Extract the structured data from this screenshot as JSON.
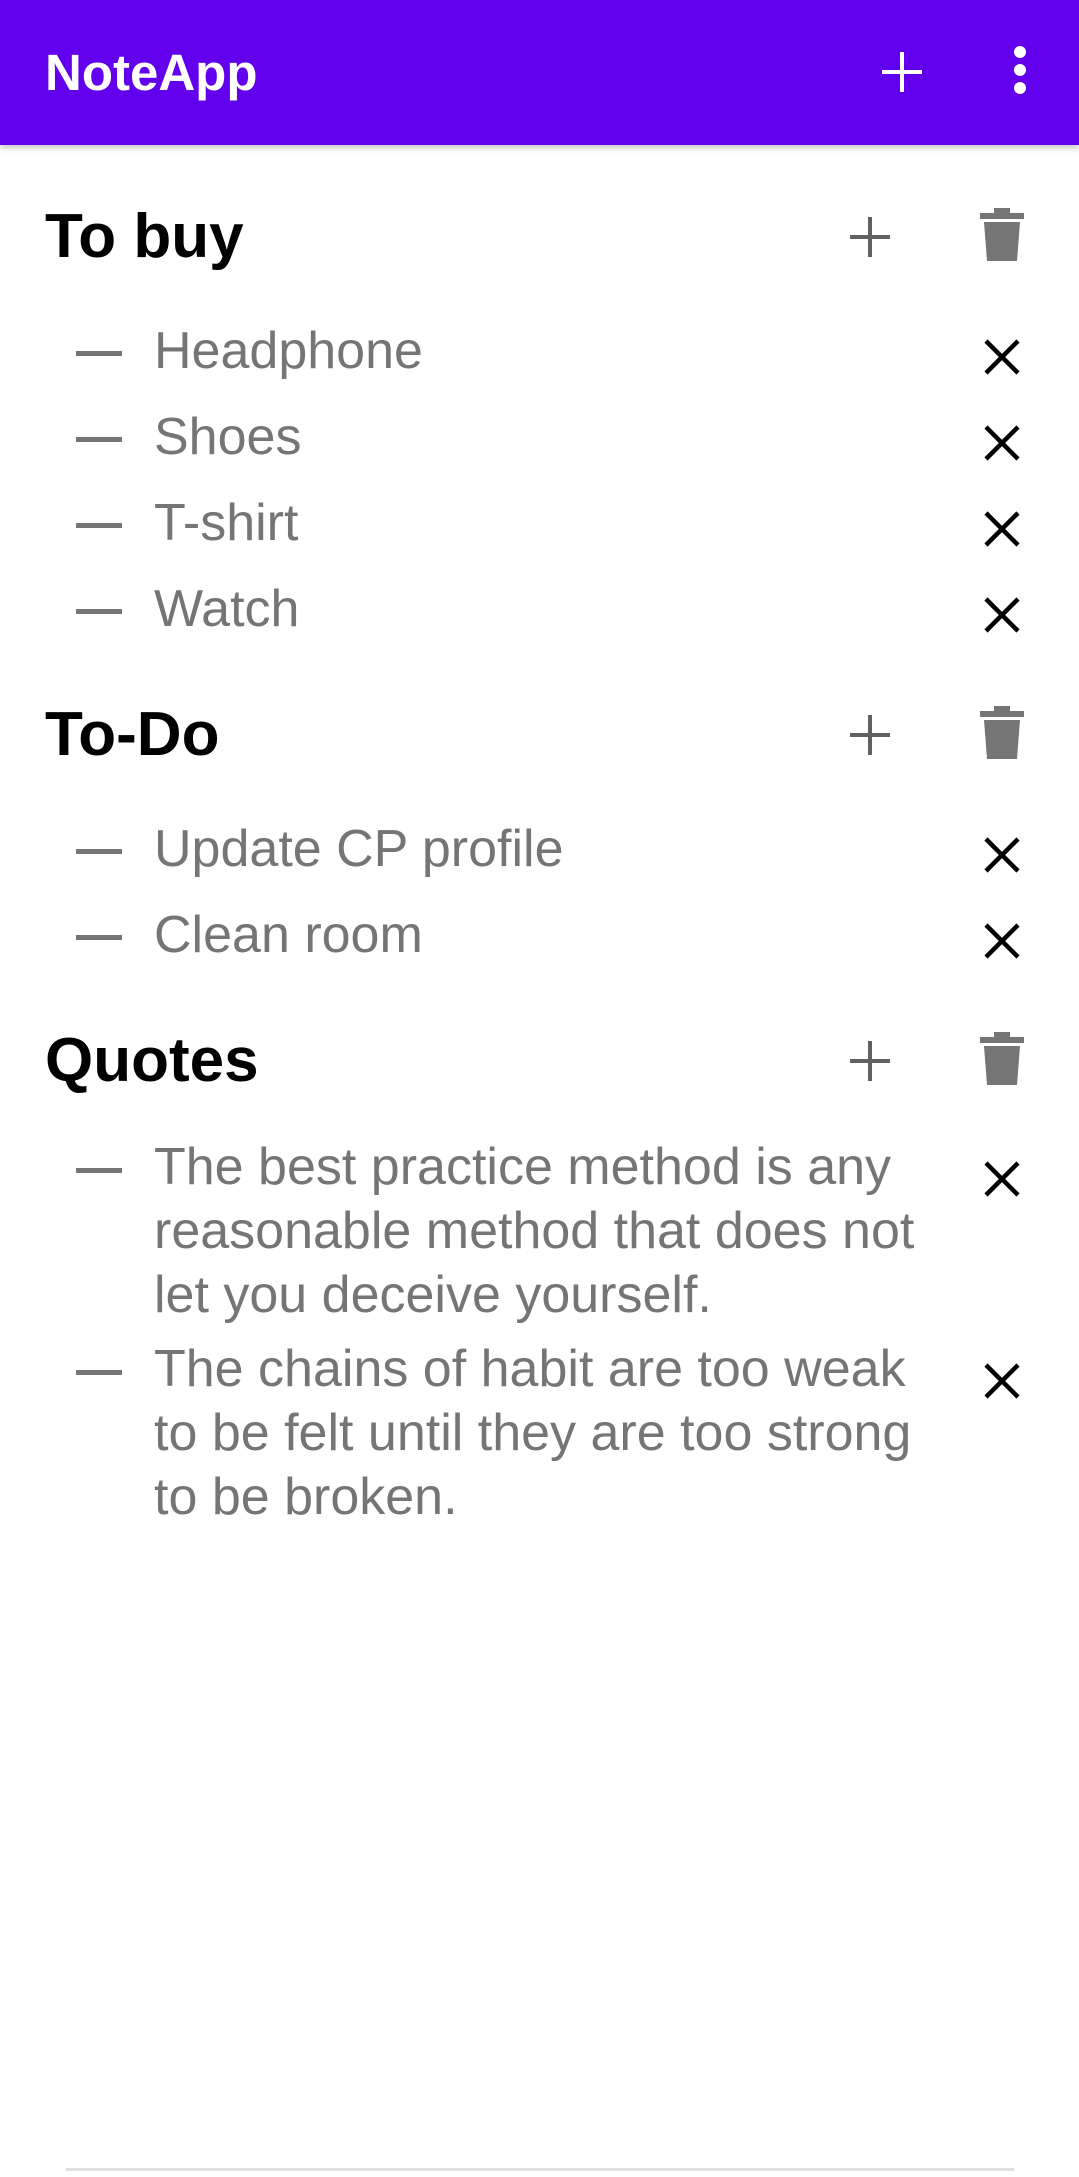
{
  "app": {
    "title": "NoteApp",
    "accent_color": "#6200EE",
    "actions": [
      {
        "icon": "plus-icon"
      },
      {
        "icon": "more-vertical-icon"
      }
    ]
  },
  "notes": [
    {
      "title": "To buy",
      "items": [
        "Headphone",
        "Shoes",
        "T-shirt",
        "Watch"
      ]
    },
    {
      "title": "To-Do",
      "items": [
        "Update CP profile",
        "Clean room"
      ]
    },
    {
      "title": "Quotes",
      "items": [
        "The best practice method is any reasonable method that does not let you deceive yourself.",
        "The chains of habit are too weak to be felt until they are too strong to be broken."
      ]
    }
  ],
  "icons": {
    "note_add": "plus-icon",
    "note_delete": "trash-icon",
    "item_remove": "close-icon"
  }
}
